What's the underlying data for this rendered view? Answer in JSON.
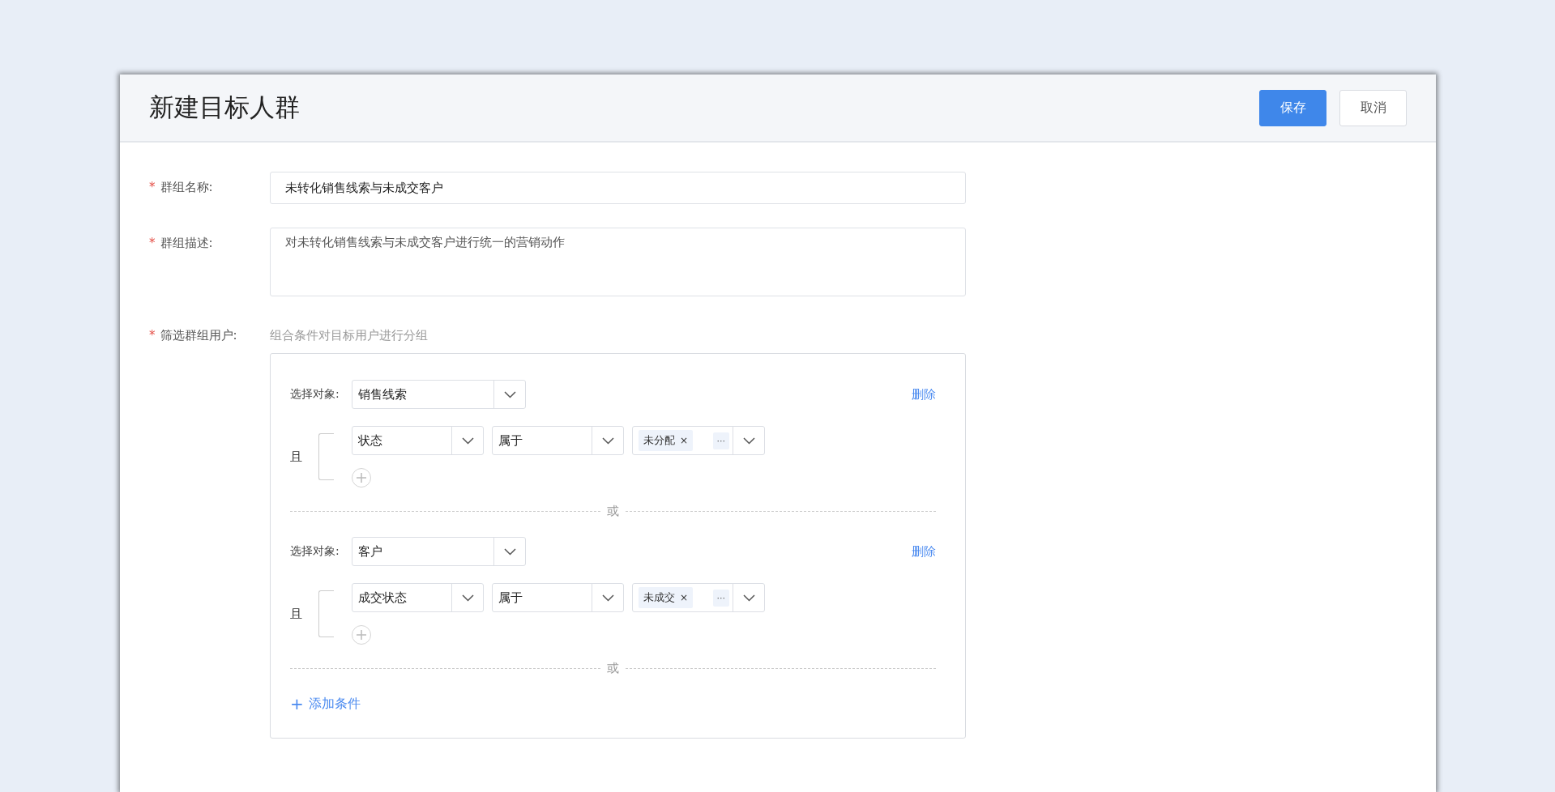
{
  "dialog": {
    "title": "新建目标人群",
    "buttons": [
      {
        "label": "保存",
        "kind": "primary"
      },
      {
        "label": "取消",
        "kind": "default"
      }
    ]
  },
  "form": {
    "name": {
      "label": "群组名称:",
      "mark": "*",
      "value": "未转化销售线索与未成交客户"
    },
    "description": {
      "label": "群组描述:",
      "mark": "*",
      "value": "对未转化销售线索与未成交客户进行统一的营销动作"
    },
    "filter": {
      "label": "筛选群组用户:",
      "mark": "*",
      "hint": "组合条件对目标用户进行分组",
      "groups": [
        {
          "object_label": "选择对象:",
          "object": "销售线索",
          "delete": "删除",
          "connector": "且",
          "conditions": [
            {
              "field": "状态",
              "operator": "属于",
              "tags": [
                {
                  "text": "未分配",
                  "close": "×"
                }
              ],
              "more": "···"
            }
          ],
          "separator": "或"
        },
        {
          "object_label": "选择对象:",
          "object": "客户",
          "delete": "删除",
          "connector": "且",
          "conditions": [
            {
              "field": "成交状态",
              "operator": "属于",
              "tags": [
                {
                  "text": "未成交",
                  "close": "×"
                }
              ],
              "more": "···"
            }
          ],
          "separator": "或"
        }
      ],
      "add": {
        "icon": "+",
        "label": "添加条件"
      }
    }
  }
}
